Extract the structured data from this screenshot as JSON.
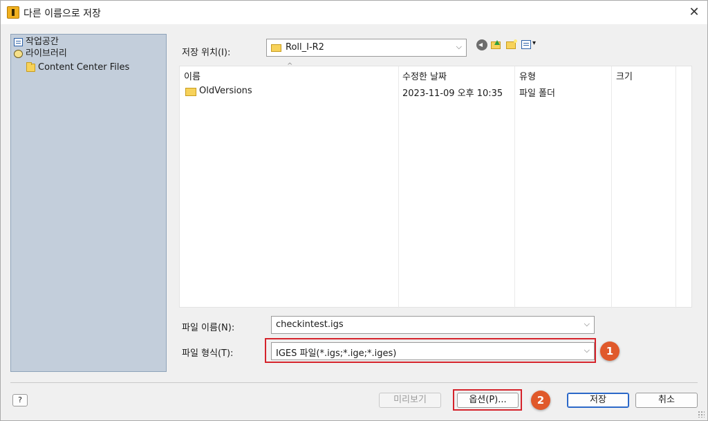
{
  "window": {
    "title": "다른 이름으로 저장",
    "close_glyph": "✕"
  },
  "places": {
    "items": [
      {
        "label": "작업공간",
        "icon": "workspace-icon"
      },
      {
        "label": "라이브러리",
        "icon": "library-icon"
      },
      {
        "label": "Content Center Files",
        "icon": "folder-icon"
      }
    ]
  },
  "location": {
    "label": "저장 위치(I):",
    "value": "Roll_I-R2"
  },
  "toolbar": {
    "icons": [
      "back-icon",
      "up-folder-icon",
      "new-folder-icon",
      "view-menu-icon"
    ],
    "view_arrow": "▾"
  },
  "file_list": {
    "columns": [
      "이름",
      "수정한 날짜",
      "유형",
      "크기"
    ],
    "sort_glyph": "^",
    "rows": [
      {
        "name": "OldVersions",
        "modified": "2023-11-09 오후 10:35",
        "type": "파일 폴더",
        "size": ""
      }
    ]
  },
  "filename": {
    "label": "파일 이름(N):",
    "value": "checkintest.igs"
  },
  "filetype": {
    "label": "파일 형식(T):",
    "value": "IGES 파일(*.igs;*.ige;*.iges)"
  },
  "buttons": {
    "preview": "미리보기",
    "options": "옵션(P)...",
    "save": "저장",
    "cancel": "취소",
    "help": "?"
  },
  "annotations": {
    "badge1": "1",
    "badge2": "2"
  },
  "chevron": "⌵",
  "colors": {
    "highlight": "#d5232b",
    "badge": "#e0592b",
    "places_bg": "#c3cedb"
  }
}
